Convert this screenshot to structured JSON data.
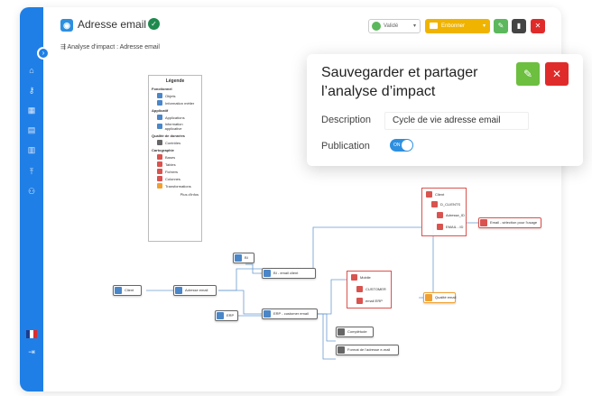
{
  "header": {
    "title": "Adresse email",
    "breadcrumb": "Analyse d'impact : Adresse email",
    "status_label": "Validé",
    "embed_label": "Enbonner"
  },
  "modal": {
    "title": "Sauvegarder et partager l’analyse d’impact",
    "description_label": "Description",
    "description_value": "Cycle de vie adresse email",
    "publication_label": "Publication",
    "toggle_label": "ON"
  },
  "legend": {
    "title": "Légende",
    "sections": [
      {
        "name": "Fonctionnel",
        "items": [
          "Objets",
          "Information métier"
        ]
      },
      {
        "name": "Applicatif",
        "items": [
          "Applications",
          "Information applicative"
        ]
      },
      {
        "name": "Qualité de données",
        "items": [
          "Contrôles"
        ]
      },
      {
        "name": "Cartographie",
        "items": [
          "Bases",
          "Tables",
          "Fichiers",
          "Colonnes",
          "Transformations"
        ]
      }
    ],
    "more": "Plus d'infos"
  },
  "nodes": {
    "client": "Client",
    "adresse": "Adresse email",
    "bi": "BI",
    "bi_email": "BI - email client",
    "erp": "ERP",
    "erp_email": "ERP - customer email",
    "crm_email": "Email - sélection pour l'usage",
    "qualite_email": "Qualité email",
    "completude": "Complétude",
    "format": "Format de l'adresse e-mail"
  },
  "group_top": [
    "Client",
    "D_CLIENTS",
    "Adresse_ID",
    "EMAIL - ID"
  ],
  "group_mid": [
    "Mobile",
    "CUSTOMER",
    "email ERP"
  ],
  "colors": {
    "sidebar": "#1f7fe6",
    "validate": "#5cb85c",
    "embed": "#f0b400",
    "edit": "#6dbf3f",
    "close": "#e02b2b"
  }
}
